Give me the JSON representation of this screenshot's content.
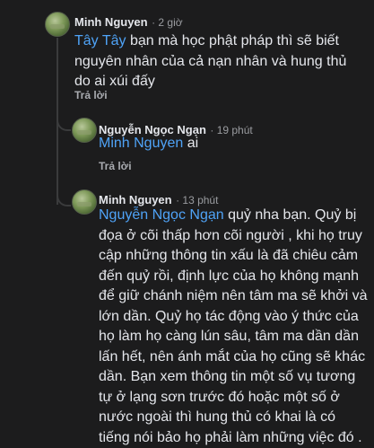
{
  "comments": [
    {
      "author": "Minh Nguyen",
      "time": "2 giờ",
      "mention": "Tây Tây",
      "text": " bạn mà học phật pháp thì sẽ biết nguyên nhân của cả nạn nhân và hung thủ do ai xúi đấy",
      "reply_label": "Trả lời"
    },
    {
      "author": "Nguyễn Ngọc Ngạn",
      "time": "19 phút",
      "mention": "Minh Nguyen",
      "text": " ai",
      "reply_label": "Trả lời"
    },
    {
      "author": "Minh Nguyen",
      "time": "13 phút",
      "mention": "Nguyễn Ngọc Ngạn",
      "text": " quỷ nha bạn. Quỷ bị đọa ở cõi thấp hơn cõi người , khi họ truy cập những thông tin xấu là đã chiêu cảm đến quỷ rồi, định lực của họ không mạnh để giữ chánh niệm nên tâm ma sẽ khởi và lớn dần. Quỷ họ tác động vào ý thức của họ làm họ càng lún sâu, tâm ma dần dần lấn hết, nên ánh mắt của họ cũng sẽ khác dần. Bạn xem thông tin một số vụ tương tự ở lạng sơn trước đó hoặc một số ở  nước ngoài thì hung thủ có khai là có tiếng nói bảo họ phải làm những việc đó ."
    }
  ]
}
